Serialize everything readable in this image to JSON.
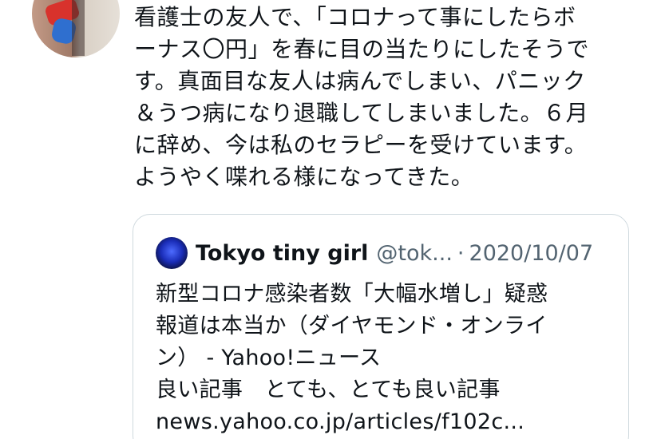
{
  "tweet": {
    "text": "看護士の友人で、「コロナって事にしたらボ\nーナス〇円」を春に目の当たりにしたそうで\nす。真面目な友人は病んでしまい、パニック\n＆うつ病になり退職してしまいました。６月\nに辞め、今は私のセラピーを受けています。\nようやく喋れる様になってきた。"
  },
  "quote": {
    "name": "Tokyo tiny girl",
    "handle": "@tok...",
    "separator": "·",
    "date": "2020/10/07",
    "text": "新型コロナ感染者数「大幅水増し」疑惑\n報道は本当か（ダイヤモンド・オンライ\nン） - Yahoo!ニュース\n良い記事　とても、とても良い記事\nnews.yahoo.co.jp/articles/f102c..."
  }
}
